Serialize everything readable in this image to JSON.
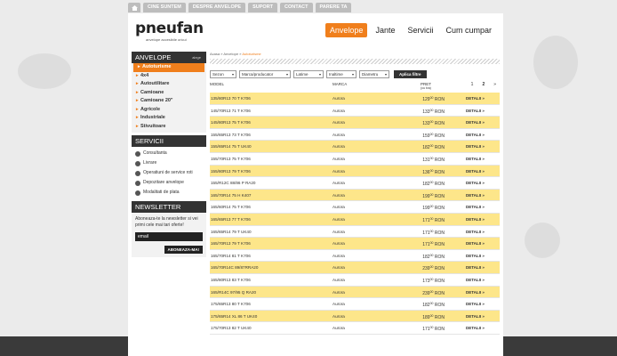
{
  "top_nav": {
    "home_icon": "home-icon",
    "items": [
      "CINE SUNTEM",
      "DESPRE ANVELOPE",
      "SUPORT",
      "CONTACT",
      "PARERE TA"
    ]
  },
  "header": {
    "logo": "pneufan",
    "tagline": "anvelope accesibile oricui",
    "nav": [
      "Anvelope",
      "Jante",
      "Servicii",
      "Cum cumpar"
    ]
  },
  "sidebar": {
    "anvelope_title": "ANVELOPE",
    "anvelope_small": "alege",
    "categories": [
      "Autoturisme",
      "4x4",
      "Autoutilitare",
      "Camioane",
      "Camioane 20\"",
      "Agricole",
      "Industriale",
      "Stivuitoare"
    ],
    "servicii_title": "SERVICII",
    "servicii": [
      "Consultanta",
      "Livrare",
      "Operatiuni de service roti",
      "Depozitare anvelope",
      "Modalitati de plata"
    ],
    "newsletter_title": "NEWSLETTER",
    "newsletter_text": "Aboneaza-te la newsletter si vei primi cele mai tari oferte!",
    "email_placeholder": "email",
    "subscribe_label": "ABONEAZA-MA!"
  },
  "breadcrumb": {
    "home": "Acasa",
    "sep": "»",
    "level1": "Anvelope",
    "current": "Autoturisme"
  },
  "filters": {
    "selects": [
      "Sezon",
      "Marca/producator",
      "Latime",
      "Inaltime",
      "Diametru"
    ],
    "apply_label": "Aplica filtre"
  },
  "table": {
    "headers": {
      "model": "MODEL",
      "marca": "MARCA",
      "pret": "PRET",
      "pret_sub": "(cu tva)"
    },
    "pager": [
      "1",
      "2",
      "»"
    ],
    "current_page": "2",
    "details_label": "DETALII »",
    "currency": "RON",
    "rows": [
      {
        "model": "135/80R13 70 T K706",
        "marca": "Aurora",
        "price": "129",
        "dec": "00",
        "highlight": true
      },
      {
        "model": "145/70R13 71 T K706",
        "marca": "Aurora",
        "price": "133",
        "dec": "00",
        "highlight": false
      },
      {
        "model": "145/80R13 75 T K706",
        "marca": "Aurora",
        "price": "133",
        "dec": "00",
        "highlight": true
      },
      {
        "model": "155/65R13 73 T K706",
        "marca": "Aurora",
        "price": "159",
        "dec": "00",
        "highlight": false
      },
      {
        "model": "155/65R14 75 T UK40",
        "marca": "Aurora",
        "price": "182",
        "dec": "00",
        "highlight": true
      },
      {
        "model": "155/70R13 75 T K706",
        "marca": "Aurora",
        "price": "131",
        "dec": "00",
        "highlight": false
      },
      {
        "model": "155/80R13 79 T K706",
        "marca": "Aurora",
        "price": "136",
        "dec": "00",
        "highlight": true
      },
      {
        "model": "155/R12C 88/86 P RA20",
        "marca": "Aurora",
        "price": "182",
        "dec": "00",
        "highlight": false
      },
      {
        "model": "165/70R14 75 H K407",
        "marca": "Aurora",
        "price": "199",
        "dec": "00",
        "highlight": true
      },
      {
        "model": "165/60R14 75 T K706",
        "marca": "Aurora",
        "price": "199",
        "dec": "00",
        "highlight": false
      },
      {
        "model": "165/65R13 77 T K706",
        "marca": "Aurora",
        "price": "171",
        "dec": "00",
        "highlight": true
      },
      {
        "model": "165/65R14 79 T UK40",
        "marca": "Aurora",
        "price": "171",
        "dec": "00",
        "highlight": false
      },
      {
        "model": "165/70R13 79 T K706",
        "marca": "Aurora",
        "price": "171",
        "dec": "00",
        "highlight": true
      },
      {
        "model": "165/70R14 81 T K706",
        "marca": "Aurora",
        "price": "182",
        "dec": "00",
        "highlight": false
      },
      {
        "model": "165/70R14C 89/87RRA20",
        "marca": "Aurora",
        "price": "239",
        "dec": "00",
        "highlight": true
      },
      {
        "model": "165/80R13 83 T K706",
        "marca": "Aurora",
        "price": "173",
        "dec": "00",
        "highlight": false
      },
      {
        "model": "165/R14C 97/95 Q RA20",
        "marca": "Aurora",
        "price": "239",
        "dec": "00",
        "highlight": true
      },
      {
        "model": "175/65R13 80 T K706",
        "marca": "Aurora",
        "price": "182",
        "dec": "00",
        "highlight": false
      },
      {
        "model": "175/65R14 XL 86 T UK40",
        "marca": "Aurora",
        "price": "189",
        "dec": "00",
        "highlight": true
      },
      {
        "model": "175/70R13 82 T UK40",
        "marca": "Aurora",
        "price": "171",
        "dec": "00",
        "highlight": false
      }
    ]
  },
  "colors": {
    "accent": "#f07f1c",
    "row_highlight": "#fde68a",
    "dark": "#333333"
  }
}
